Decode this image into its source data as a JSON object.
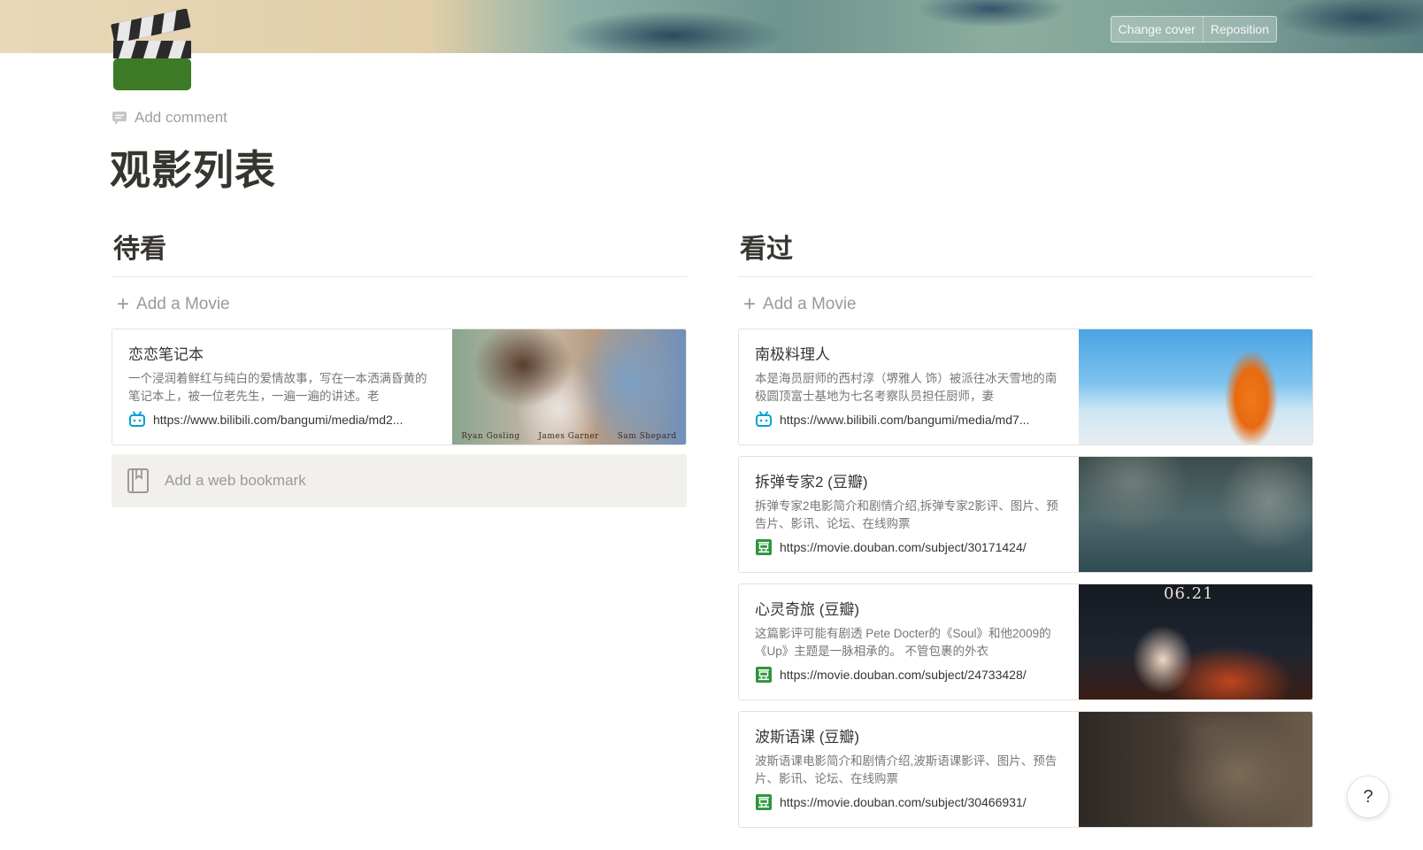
{
  "cover": {
    "change_cover": "Change cover",
    "reposition": "Reposition"
  },
  "page": {
    "icon": "clapperboard-icon",
    "add_comment": "Add comment",
    "title": "观影列表"
  },
  "colors": {
    "text": "#37352f",
    "muted": "#9b9a97",
    "bilibili": "#00a1d6",
    "douban": "#2e963d"
  },
  "left": {
    "heading": "待看",
    "add_movie": "Add a Movie",
    "bookmarks": [
      {
        "title": "恋恋笔记本",
        "desc": "一个浸润着鲜红与纯白的爱情故事，写在一本洒满昏黄的笔记本上，被一位老先生，一遍一遍的讲述。老",
        "source_icon": "bilibili-icon",
        "url": "https://www.bilibili.com/bangumi/media/md2...",
        "thumb_caption": [
          "Ryan Gosling",
          "James Garner",
          "Sam Shepard"
        ]
      }
    ],
    "add_bookmark": "Add a web bookmark"
  },
  "right": {
    "heading": "看过",
    "add_movie": "Add a Movie",
    "bookmarks": [
      {
        "title": "南极料理人",
        "desc": "本是海员厨师的西村淳（堺雅人 饰）被派往冰天雪地的南极圆顶富士基地为七名考察队员担任厨师，妻",
        "source_icon": "bilibili-icon",
        "url": "https://www.bilibili.com/bangumi/media/md7..."
      },
      {
        "title": "拆弹专家2 (豆瓣)",
        "desc": "拆弹专家2电影简介和剧情介绍,拆弹专家2影评、图片、预告片、影讯、论坛、在线购票",
        "source_icon": "douban-icon",
        "url": "https://movie.douban.com/subject/30171424/"
      },
      {
        "title": "心灵奇旅 (豆瓣)",
        "desc": "这篇影评可能有剧透 Pete Docter的《Soul》和他2009的《Up》主题是一脉相承的。 不管包裹的外衣",
        "source_icon": "douban-icon",
        "url": "https://movie.douban.com/subject/24733428/",
        "thumb_date": "06.21"
      },
      {
        "title": "波斯语课 (豆瓣)",
        "desc": "波斯语课电影简介和剧情介绍,波斯语课影评、图片、预告片、影讯、论坛、在线购票",
        "source_icon": "douban-icon",
        "url": "https://movie.douban.com/subject/30466931/"
      }
    ]
  },
  "help": {
    "label": "?"
  }
}
